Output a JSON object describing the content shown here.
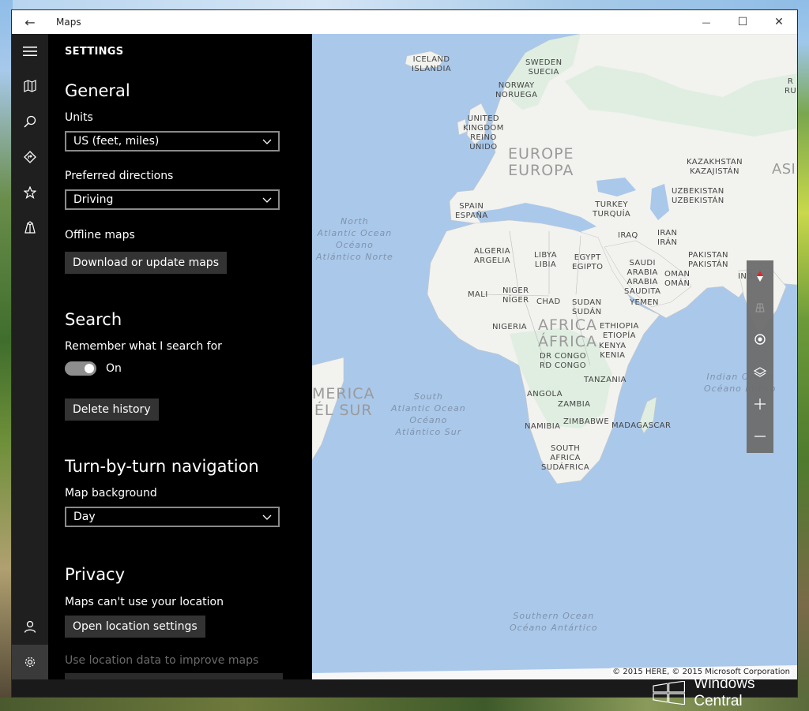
{
  "window": {
    "title": "Maps"
  },
  "titlebar": {
    "back_glyph": "←",
    "minimize_glyph": "—",
    "maximize_glyph": "☐",
    "close_glyph": "✕"
  },
  "rail": {
    "items": [
      {
        "icon": "hamburger-menu-icon"
      },
      {
        "icon": "map-icon"
      },
      {
        "icon": "search-icon"
      },
      {
        "icon": "directions-icon"
      },
      {
        "icon": "favorites-star-icon"
      },
      {
        "icon": "3d-cities-icon"
      },
      {
        "icon": "account-icon"
      },
      {
        "icon": "settings-gear-icon"
      }
    ]
  },
  "settings": {
    "header": "SETTINGS",
    "general": {
      "heading": "General",
      "units_label": "Units",
      "units_value": "US (feet, miles)",
      "directions_label": "Preferred directions",
      "directions_value": "Driving",
      "offline_label": "Offline maps",
      "offline_button": "Download or update maps"
    },
    "search": {
      "heading": "Search",
      "remember_label": "Remember what I search for",
      "toggle_state": "On",
      "delete_button": "Delete history"
    },
    "navigation": {
      "heading": "Turn-by-turn navigation",
      "background_label": "Map background",
      "background_value": "Day"
    },
    "privacy": {
      "heading": "Privacy",
      "location_text": "Maps can't use your location",
      "location_button": "Open location settings",
      "improve_label": "Use location data to improve maps"
    }
  },
  "map": {
    "labels": [
      {
        "text": "ICELAND\nISLANDIA"
      },
      {
        "text": "SWEDEN\nSUECIA"
      },
      {
        "text": "NORWAY\nNORUEGA"
      },
      {
        "text": "UNITED\nKINGDOM\nREINO\nUNIDO"
      },
      {
        "text": "KAZAKHSTAN\nKAZAJISTÁN"
      },
      {
        "text": "UZBEKISTAN\nUZBEKISTÁN"
      },
      {
        "text": "SPAIN\nESPAÑA"
      },
      {
        "text": "TURKEY\nTURQUÍA"
      },
      {
        "text": "IRAQ"
      },
      {
        "text": "IRAN\nIRÁN"
      },
      {
        "text": "PAKISTAN\nPAKISTÁN"
      },
      {
        "text": "INDIA"
      },
      {
        "text": "ALGERIA\nARGELIA"
      },
      {
        "text": "LIBYA\nLIBIA"
      },
      {
        "text": "EGYPT\nEGIPTO"
      },
      {
        "text": "SAUDI\nARABIA\nARABIA\nSAUDITA"
      },
      {
        "text": "OMAN\nOMÁN"
      },
      {
        "text": "YEMEN"
      },
      {
        "text": "MALI"
      },
      {
        "text": "NIGER\nNÍGER"
      },
      {
        "text": "CHAD"
      },
      {
        "text": "SUDAN\nSUDÁN"
      },
      {
        "text": "NIGERIA"
      },
      {
        "text": "ETHIOPIA\nETIOPÍA"
      },
      {
        "text": "KENYA\nKENIA"
      },
      {
        "text": "DR CONGO\nRD CONGO"
      },
      {
        "text": "TANZANIA"
      },
      {
        "text": "ANGOLA"
      },
      {
        "text": "ZAMBIA"
      },
      {
        "text": "NAMIBIA"
      },
      {
        "text": "ZIMBABWE"
      },
      {
        "text": "MADAGASCAR"
      },
      {
        "text": "SOUTH\nAFRICA\nSUDÁFRICA"
      },
      {
        "text": "R\nRU"
      },
      {
        "text": "ASI"
      }
    ],
    "big_labels": [
      {
        "text": "EUROPE\nEUROPA"
      },
      {
        "text": "AFRICA\nÁFRICA"
      },
      {
        "text": "MERICA\nÉL SUR"
      }
    ],
    "ocean_labels": [
      {
        "text": "North\nAtlantic Ocean\nOcéano\nAtlántico Norte"
      },
      {
        "text": "South\nAtlantic Ocean\nOcéano\nAtlántico Sur"
      },
      {
        "text": "Indian Ocean\nOcéano Índico"
      },
      {
        "text": "Southern Ocean\nOcéano Antártico"
      }
    ],
    "controls": [
      {
        "icon": "compass-icon"
      },
      {
        "icon": "tilt-grid-icon"
      },
      {
        "icon": "my-location-icon"
      },
      {
        "icon": "map-layers-icon"
      },
      {
        "icon": "zoom-in-icon"
      },
      {
        "icon": "zoom-out-icon"
      }
    ],
    "attribution": "© 2015 HERE, © 2015 Microsoft Corporation"
  },
  "watermark": {
    "text": "Windows Central"
  },
  "colors": {
    "window_bg": "#000000",
    "rail_bg": "#1f1f1f",
    "map_water": "#aac8ea",
    "map_land": "#f2f2ef",
    "controls_bg": "#6d6d6d"
  }
}
